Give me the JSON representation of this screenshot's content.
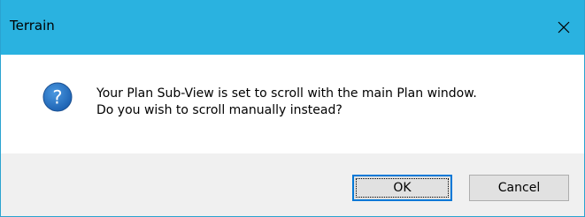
{
  "window": {
    "title": "Terrain",
    "title_bar_color": "#2ab2e0",
    "close_icon": "close-icon"
  },
  "message": {
    "icon": "question-icon",
    "icon_color": "#1e6fc1",
    "line1": "Your Plan Sub-View is set to scroll with the main Plan window.",
    "line2": "Do you wish to scroll manually instead?"
  },
  "buttons": {
    "ok_label": "OK",
    "cancel_label": "Cancel",
    "default_button": "OK",
    "accent_color": "#0078d7"
  }
}
